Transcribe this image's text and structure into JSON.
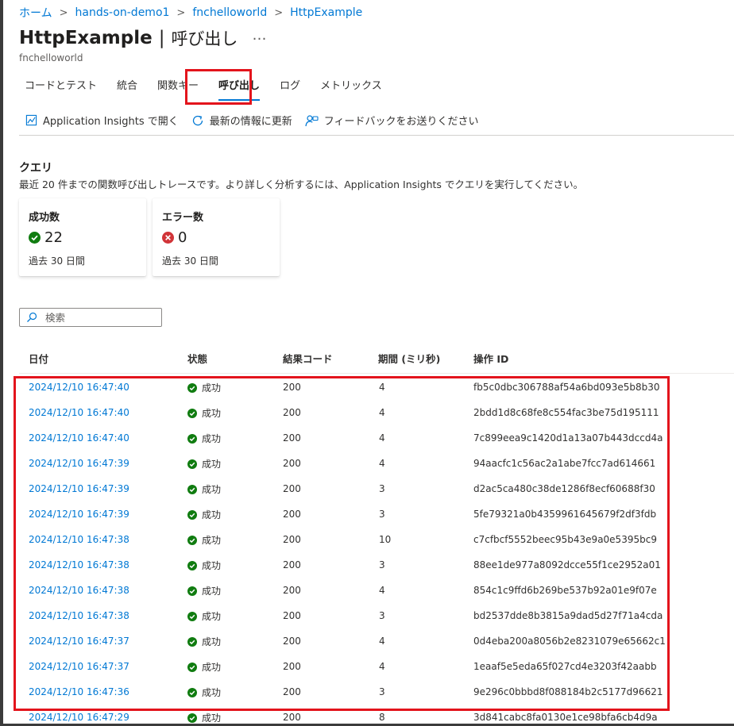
{
  "breadcrumb": [
    "ホーム",
    "hands-on-demo1",
    "fnchelloworld",
    "HttpExample"
  ],
  "header": {
    "title": "HttpExample",
    "separator": "|",
    "subtitle": "呼び出し",
    "more": "…",
    "caption": "fnchelloworld"
  },
  "tabs": [
    {
      "label": "コードとテスト"
    },
    {
      "label": "統合"
    },
    {
      "label": "関数キー"
    },
    {
      "label": "呼び出し",
      "active": true
    },
    {
      "label": "ログ"
    },
    {
      "label": "メトリックス"
    }
  ],
  "toolbar": {
    "app_insights": {
      "label": "Application Insights で開く",
      "icon": "chart-icon"
    },
    "refresh": {
      "label": "最新の情報に更新",
      "icon": "refresh-icon"
    },
    "feedback": {
      "label": "フィードバックをお送りください",
      "icon": "feedback-icon"
    }
  },
  "query": {
    "title": "クエリ",
    "description": "最近 20 件までの関数呼び出しトレースです。より詳しく分析するには、Application Insights でクエリを実行してください。"
  },
  "cards": {
    "success": {
      "label": "成功数",
      "value": "22",
      "period": "過去 30 日間",
      "icon": "success-check-icon",
      "color": "#107c10"
    },
    "error": {
      "label": "エラー数",
      "value": "0",
      "period": "過去 30 日間",
      "icon": "error-x-icon",
      "color": "#d13438"
    }
  },
  "search": {
    "placeholder": "検索",
    "value": ""
  },
  "table": {
    "columns": [
      "日付",
      "状態",
      "結果コード",
      "期間 (ミリ秒)",
      "操作 ID"
    ],
    "rows": [
      {
        "date": "2024/12/10 16:47:40",
        "status": "成功",
        "code": "200",
        "duration": "4",
        "id": "fb5c0dbc306788af54a6bd093e5b8b30"
      },
      {
        "date": "2024/12/10 16:47:40",
        "status": "成功",
        "code": "200",
        "duration": "4",
        "id": "2bdd1d8c68fe8c554fac3be75d195111"
      },
      {
        "date": "2024/12/10 16:47:40",
        "status": "成功",
        "code": "200",
        "duration": "4",
        "id": "7c899eea9c1420d1a13a07b443dccd4a"
      },
      {
        "date": "2024/12/10 16:47:39",
        "status": "成功",
        "code": "200",
        "duration": "4",
        "id": "94aacfc1c56ac2a1abe7fcc7ad614661"
      },
      {
        "date": "2024/12/10 16:47:39",
        "status": "成功",
        "code": "200",
        "duration": "3",
        "id": "d2ac5ca480c38de1286f8ecf60688f30"
      },
      {
        "date": "2024/12/10 16:47:39",
        "status": "成功",
        "code": "200",
        "duration": "3",
        "id": "5fe79321a0b4359961645679f2df3fdb"
      },
      {
        "date": "2024/12/10 16:47:38",
        "status": "成功",
        "code": "200",
        "duration": "10",
        "id": "c7cfbcf5552beec95b43e9a0e5395bc9"
      },
      {
        "date": "2024/12/10 16:47:38",
        "status": "成功",
        "code": "200",
        "duration": "3",
        "id": "88ee1de977a8092dcce55f1ce2952a01"
      },
      {
        "date": "2024/12/10 16:47:38",
        "status": "成功",
        "code": "200",
        "duration": "4",
        "id": "854c1c9ffd6b269be537b92a01e9f07e"
      },
      {
        "date": "2024/12/10 16:47:38",
        "status": "成功",
        "code": "200",
        "duration": "3",
        "id": "bd2537dde8b3815a9dad5d27f71a4cda"
      },
      {
        "date": "2024/12/10 16:47:37",
        "status": "成功",
        "code": "200",
        "duration": "4",
        "id": "0d4eba200a8056b2e8231079e65662c1"
      },
      {
        "date": "2024/12/10 16:47:37",
        "status": "成功",
        "code": "200",
        "duration": "4",
        "id": "1eaaf5e5eda65f027cd4e3203f42aabb"
      },
      {
        "date": "2024/12/10 16:47:36",
        "status": "成功",
        "code": "200",
        "duration": "3",
        "id": "9e296c0bbbd8f088184b2c5177d96621"
      },
      {
        "date": "2024/12/10 16:47:29",
        "status": "成功",
        "code": "200",
        "duration": "8",
        "id": "3d841cabc8fa0130e1ce98bfa6cb4d9a"
      }
    ]
  },
  "colors": {
    "link": "#0078d4",
    "highlight": "#e3141c",
    "success": "#107c10",
    "error": "#d13438"
  }
}
